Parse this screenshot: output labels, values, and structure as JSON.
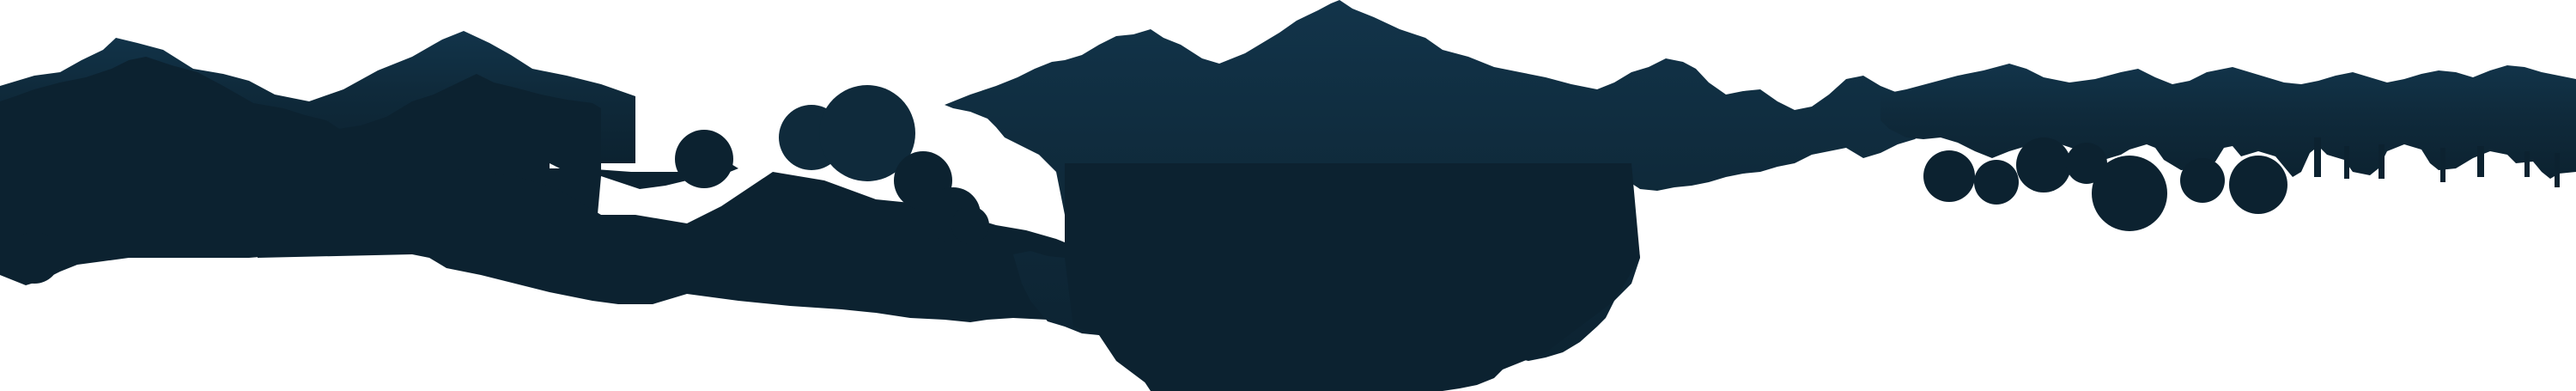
{
  "scene": {
    "colors": {
      "background": "#ffffff",
      "silhouette": "#0c2230",
      "silhouette_top": "#12344a",
      "silhouette_mid": "#0f2a3b"
    }
  }
}
